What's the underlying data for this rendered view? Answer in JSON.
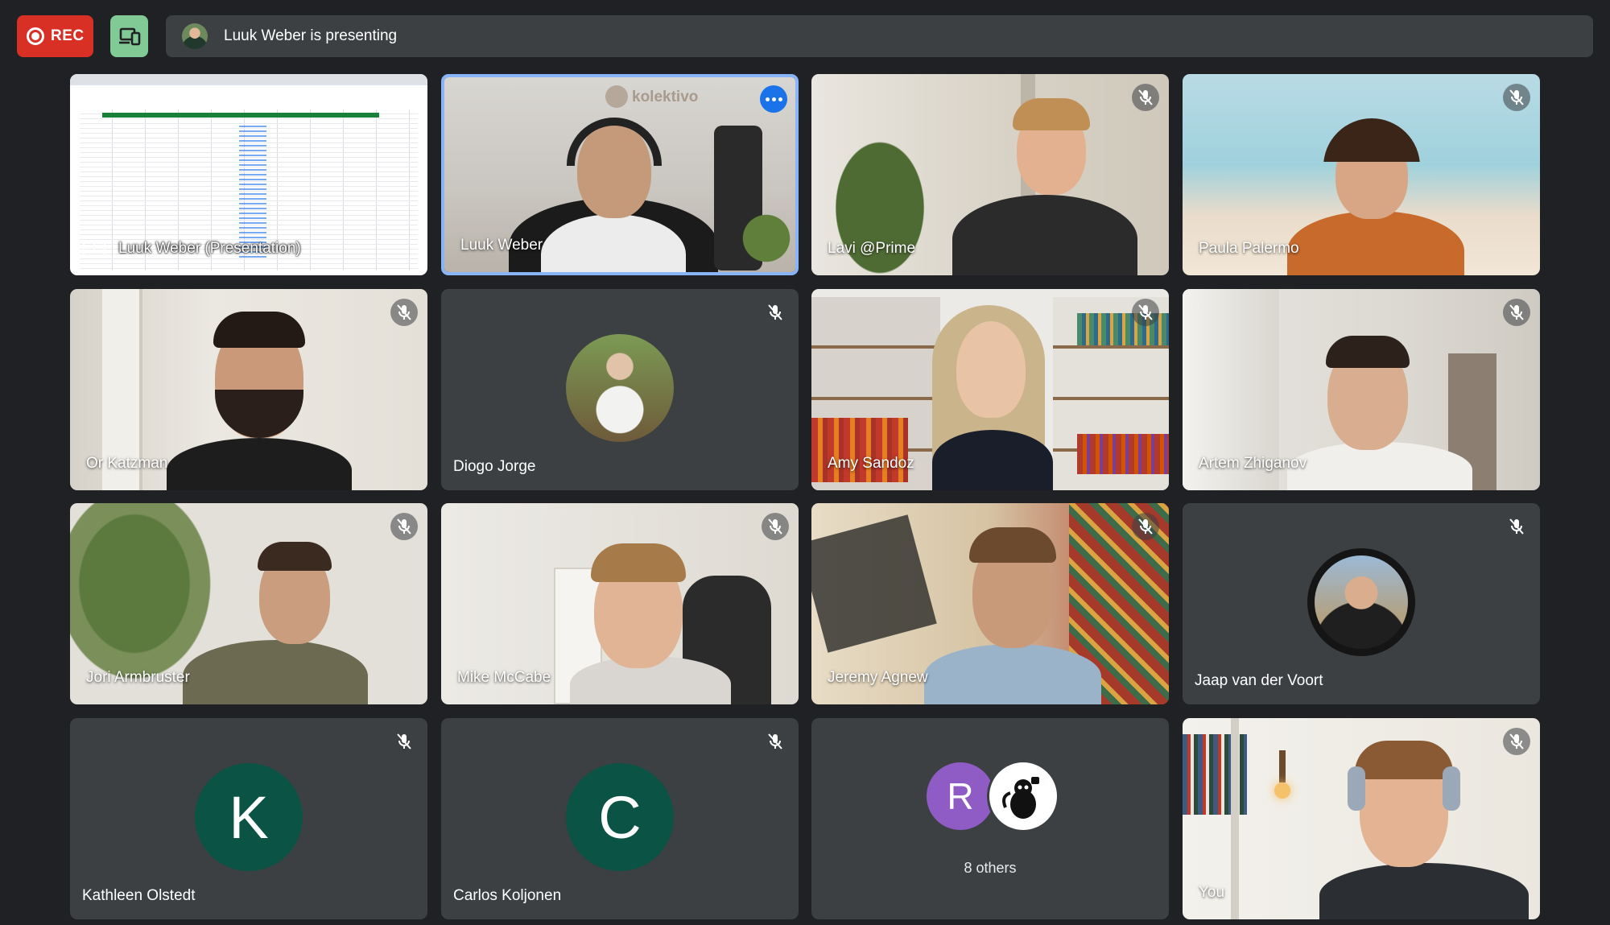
{
  "topbar": {
    "rec_label": "REC",
    "presenting_text": "Luuk Weber is presenting"
  },
  "tiles": [
    {
      "name": "Luuk Weber (Presentation)"
    },
    {
      "name": "Luuk Weber"
    },
    {
      "name": "Lavi @Prime"
    },
    {
      "name": "Paula Palermo"
    },
    {
      "name": "Or Katzman"
    },
    {
      "name": "Diogo Jorge"
    },
    {
      "name": "Amy Sandoz"
    },
    {
      "name": "Artem Zhiganov"
    },
    {
      "name": "Jori Armbruster"
    },
    {
      "name": "Mike McCabe"
    },
    {
      "name": "Jeremy Agnew"
    },
    {
      "name": "Jaap van der Voort"
    },
    {
      "name": "Kathleen Olstedt",
      "initial": "K"
    },
    {
      "name": "Carlos Koljonen",
      "initial": "C"
    },
    {
      "others_label": "8 others",
      "initial": "R"
    },
    {
      "name": "You"
    }
  ],
  "brand_watermark": "kolektivo",
  "colors": {
    "rec": "#d93025",
    "device_button": "#81c995",
    "active_speaker_border": "#8ab4f8",
    "initial_avatar": "#0b5345",
    "others_avatar": "#8e5cc4"
  }
}
